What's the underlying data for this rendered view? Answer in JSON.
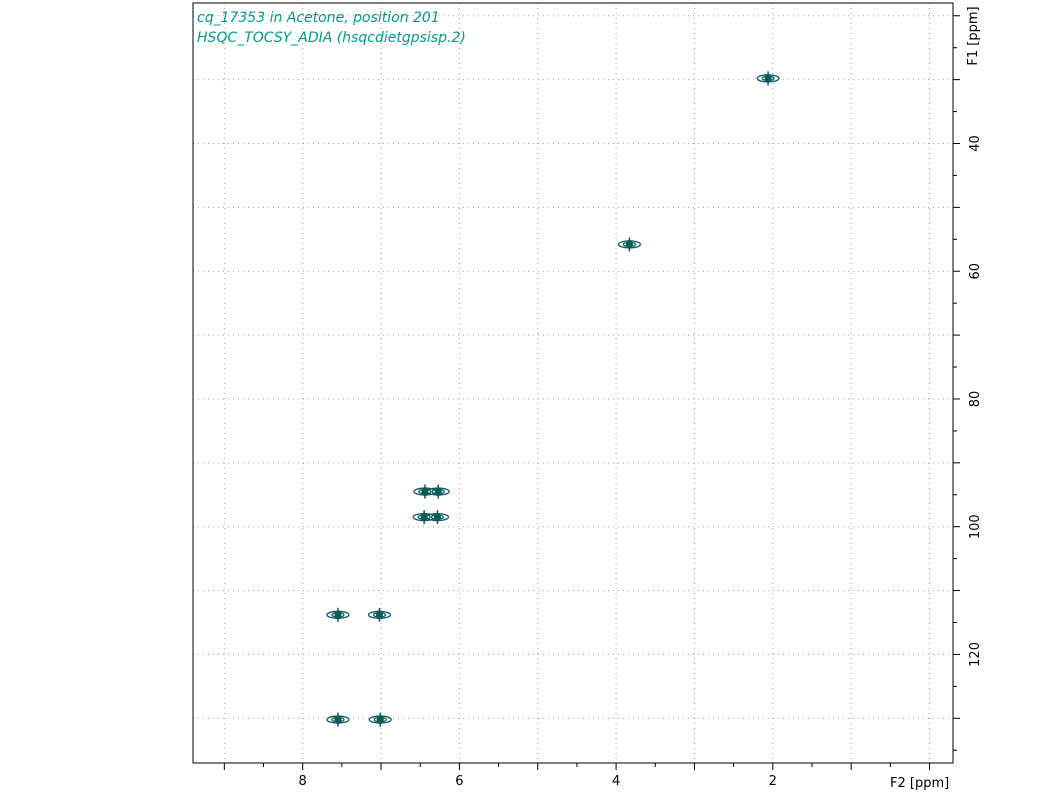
{
  "chart_data": {
    "type": "scatter",
    "title_lines": [
      "cq_17353 in Acetone, position 201",
      "HSQC_TOCSY_ADIA (hsqcdietgpsisp.2)"
    ],
    "xlabel": "F2 [ppm]",
    "ylabel": "F1 [ppm]",
    "x_reversed": true,
    "xlim": [
      9.4,
      -0.3
    ],
    "ylim": [
      18.0,
      137.0
    ],
    "x_ticks": [
      8,
      6,
      4,
      2
    ],
    "y_ticks": [
      40,
      60,
      80,
      100,
      120
    ],
    "grid": true,
    "series": [
      {
        "points": [
          {
            "x": 2.06,
            "y": 29.8
          },
          {
            "x": 3.83,
            "y": 55.8
          },
          {
            "x": 6.44,
            "y": 94.5
          },
          {
            "x": 6.27,
            "y": 94.5
          },
          {
            "x": 6.45,
            "y": 98.5
          },
          {
            "x": 6.28,
            "y": 98.5
          },
          {
            "x": 7.55,
            "y": 113.8
          },
          {
            "x": 7.02,
            "y": 113.8
          },
          {
            "x": 7.55,
            "y": 130.2
          },
          {
            "x": 7.01,
            "y": 130.2
          }
        ]
      }
    ]
  },
  "colors": {
    "title": "#00998f",
    "peak": "#0c5a5a",
    "grid": "#a0a0a0",
    "axis": "#000000"
  }
}
